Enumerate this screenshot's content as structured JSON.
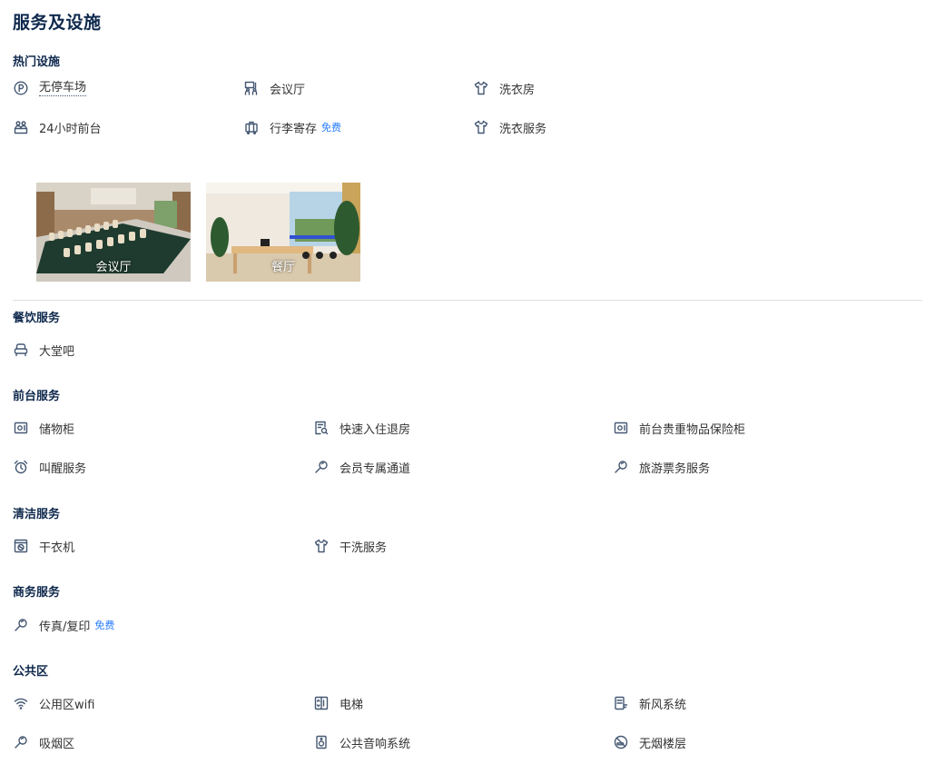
{
  "page": {
    "title": "服务及设施"
  },
  "hot": {
    "title": "热门设施",
    "items": [
      {
        "label": "无停车场",
        "icon": "parking-icon"
      },
      {
        "label": "会议厅",
        "icon": "meeting-icon"
      },
      {
        "label": "洗衣房",
        "icon": "shirt-icon"
      },
      {
        "label": "24小时前台",
        "icon": "reception-icon"
      },
      {
        "label": "行李寄存",
        "icon": "luggage-icon",
        "badge": "免费"
      },
      {
        "label": "洗衣服务",
        "icon": "shirt-icon"
      }
    ]
  },
  "photos": [
    {
      "caption": "会议厅"
    },
    {
      "caption": "餐厅"
    }
  ],
  "dining": {
    "title": "餐饮服务",
    "items": [
      {
        "label": "大堂吧",
        "icon": "armchair-icon"
      }
    ]
  },
  "front": {
    "title": "前台服务",
    "items": [
      {
        "label": "储物柜",
        "icon": "safe-icon"
      },
      {
        "label": "快速入住退房",
        "icon": "checkin-icon"
      },
      {
        "label": "前台贵重物品保险柜",
        "icon": "safe-icon"
      },
      {
        "label": "叫醒服务",
        "icon": "alarm-icon"
      },
      {
        "label": "会员专属通道",
        "icon": "service-icon"
      },
      {
        "label": "旅游票务服务",
        "icon": "service-icon"
      }
    ]
  },
  "cleaning": {
    "title": "清洁服务",
    "items": [
      {
        "label": "干衣机",
        "icon": "dryer-icon"
      },
      {
        "label": "干洗服务",
        "icon": "shirt-icon"
      }
    ]
  },
  "business": {
    "title": "商务服务",
    "items": [
      {
        "label": "传真/复印",
        "icon": "service-icon",
        "badge": "免费"
      }
    ]
  },
  "public": {
    "title": "公共区",
    "items": [
      {
        "label": "公用区wifi",
        "icon": "wifi-icon"
      },
      {
        "label": "电梯",
        "icon": "elevator-icon"
      },
      {
        "label": "新风系统",
        "icon": "ventilation-icon"
      },
      {
        "label": "吸烟区",
        "icon": "service-icon"
      },
      {
        "label": "公共音响系统",
        "icon": "speaker-icon"
      },
      {
        "label": "无烟楼层",
        "icon": "no-smoking-icon"
      }
    ]
  },
  "colors": {
    "title": "#0f294d",
    "icon": "#455873",
    "badge": "#287dfa",
    "divider": "#dcdfe4"
  }
}
